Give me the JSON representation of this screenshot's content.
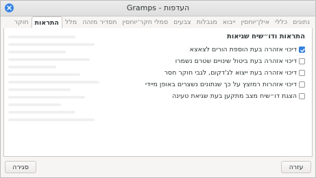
{
  "window": {
    "title": "Gramps - העדפות"
  },
  "tabs": [
    {
      "label": "נתונים",
      "active": false
    },
    {
      "label": "כללי",
      "active": false
    },
    {
      "label": "אילן־יוחסין",
      "active": false
    },
    {
      "label": "ייבוא",
      "active": false
    },
    {
      "label": "מגבלות",
      "active": false
    },
    {
      "label": "צבעים",
      "active": false
    },
    {
      "label": "סמלי חקר־יוחסין",
      "active": false
    },
    {
      "label": "תסדיר מזהה",
      "active": false
    },
    {
      "label": "מלל",
      "active": false
    },
    {
      "label": "התראות",
      "active": true
    },
    {
      "label": "חוקר",
      "active": false
    }
  ],
  "section": {
    "title": "התראות ודו״שיח שגיאות"
  },
  "options": [
    {
      "label": "דיכוי אזהרה בעת הוספת הורים לצאצא",
      "checked": true
    },
    {
      "label": "דיכוי אזהרה בעת ביטול שינויים שטרם נשמרו",
      "checked": false
    },
    {
      "label": "דיכוי אזהרה בעת ייצוא לג'דקום, לגבי חוקר חסר",
      "checked": false
    },
    {
      "label": "דיכוי אזהרות רמזצץ על כך שנתונים נשצרים באופן מיידי",
      "checked": false
    },
    {
      "label": "הצגת דו״שיח מצב מתקען בעת שגיאת טעינה",
      "checked": false
    }
  ],
  "footer": {
    "close_label": "סגירה",
    "help_label": "עזרה"
  },
  "colors": {
    "accent": "#3584e4"
  }
}
